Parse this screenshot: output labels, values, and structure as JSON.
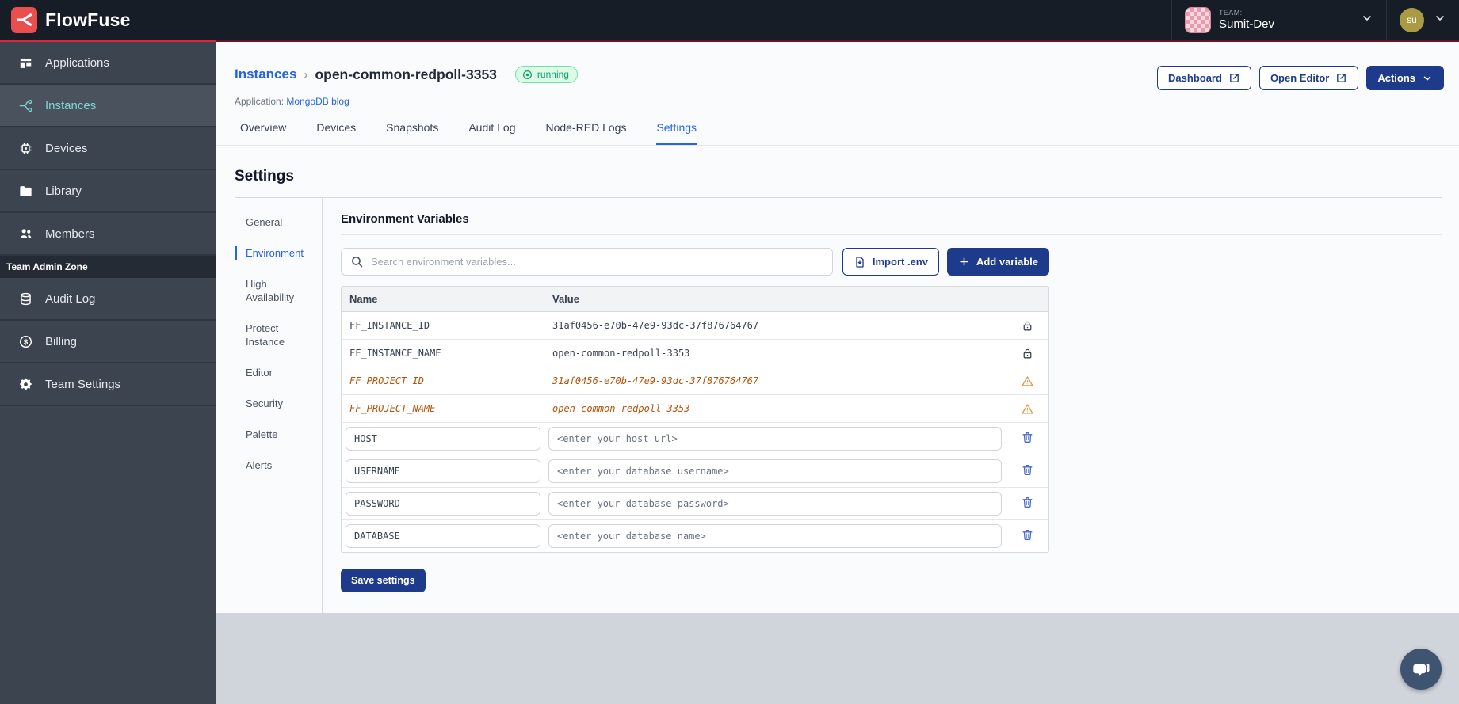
{
  "nav": {
    "brand": "FlowFuse",
    "team_label": "TEAM:",
    "team_name": "Sumit-Dev",
    "user_initials": "su"
  },
  "sidebar": {
    "items": [
      {
        "label": "Applications",
        "icon": "applications-icon",
        "active": false
      },
      {
        "label": "Instances",
        "icon": "instances-icon",
        "active": true
      },
      {
        "label": "Devices",
        "icon": "devices-icon",
        "active": false
      },
      {
        "label": "Library",
        "icon": "library-icon",
        "active": false
      },
      {
        "label": "Members",
        "icon": "members-icon",
        "active": false
      }
    ],
    "section_label": "Team Admin Zone",
    "admin_items": [
      {
        "label": "Audit Log",
        "icon": "audit-log-icon",
        "active": false
      },
      {
        "label": "Billing",
        "icon": "billing-icon",
        "active": false
      },
      {
        "label": "Team Settings",
        "icon": "team-settings-icon",
        "active": false
      }
    ]
  },
  "header": {
    "breadcrumb_root": "Instances",
    "breadcrumb_sep": "›",
    "instance_name": "open-common-redpoll-3353",
    "status": "running",
    "application_label": "Application:",
    "application_name": "MongoDB blog",
    "dashboard_label": "Dashboard",
    "open_editor_label": "Open Editor",
    "actions_label": "Actions"
  },
  "tabs": {
    "items": [
      "Overview",
      "Devices",
      "Snapshots",
      "Audit Log",
      "Node-RED Logs",
      "Settings"
    ],
    "active": "Settings"
  },
  "settings": {
    "title": "Settings",
    "nav": [
      "General",
      "Environment",
      "High Availability",
      "Protect Instance",
      "Editor",
      "Security",
      "Palette",
      "Alerts"
    ],
    "nav_active": "Environment",
    "panel_title": "Environment Variables",
    "search_placeholder": "Search environment variables...",
    "import_label": "Import .env",
    "add_label": "Add variable",
    "save_label": "Save settings",
    "table": {
      "headers": [
        "Name",
        "Value"
      ],
      "locked_rows": [
        {
          "name": "FF_INSTANCE_ID",
          "value": "31af0456-e70b-47e9-93dc-37f876764767",
          "icon": "lock-icon",
          "deprecated": false
        },
        {
          "name": "FF_INSTANCE_NAME",
          "value": "open-common-redpoll-3353",
          "icon": "lock-icon",
          "deprecated": false
        },
        {
          "name": "FF_PROJECT_ID",
          "value": "31af0456-e70b-47e9-93dc-37f876764767",
          "icon": "warning-icon",
          "deprecated": true
        },
        {
          "name": "FF_PROJECT_NAME",
          "value": "open-common-redpoll-3353",
          "icon": "warning-icon",
          "deprecated": true
        }
      ],
      "editable_rows": [
        {
          "name": "HOST",
          "placeholder": "<enter your host url>"
        },
        {
          "name": "USERNAME",
          "placeholder": "<enter your database username>"
        },
        {
          "name": "PASSWORD",
          "placeholder": "<enter your database password>"
        },
        {
          "name": "DATABASE",
          "placeholder": "<enter your database name>"
        }
      ]
    }
  },
  "colors": {
    "navbar_bg": "#161d27",
    "accent_red": "#e02339",
    "sidebar_bg": "#3c4450",
    "sidebar_active_text": "#7cd6d4",
    "primary_navy": "#1e3a8a",
    "link_blue": "#2563eb",
    "running_green": "#0e9f6e",
    "deprecated_orange": "#b45309",
    "warning_orange": "#e8923e",
    "footer_gray": "#d0d4db"
  }
}
